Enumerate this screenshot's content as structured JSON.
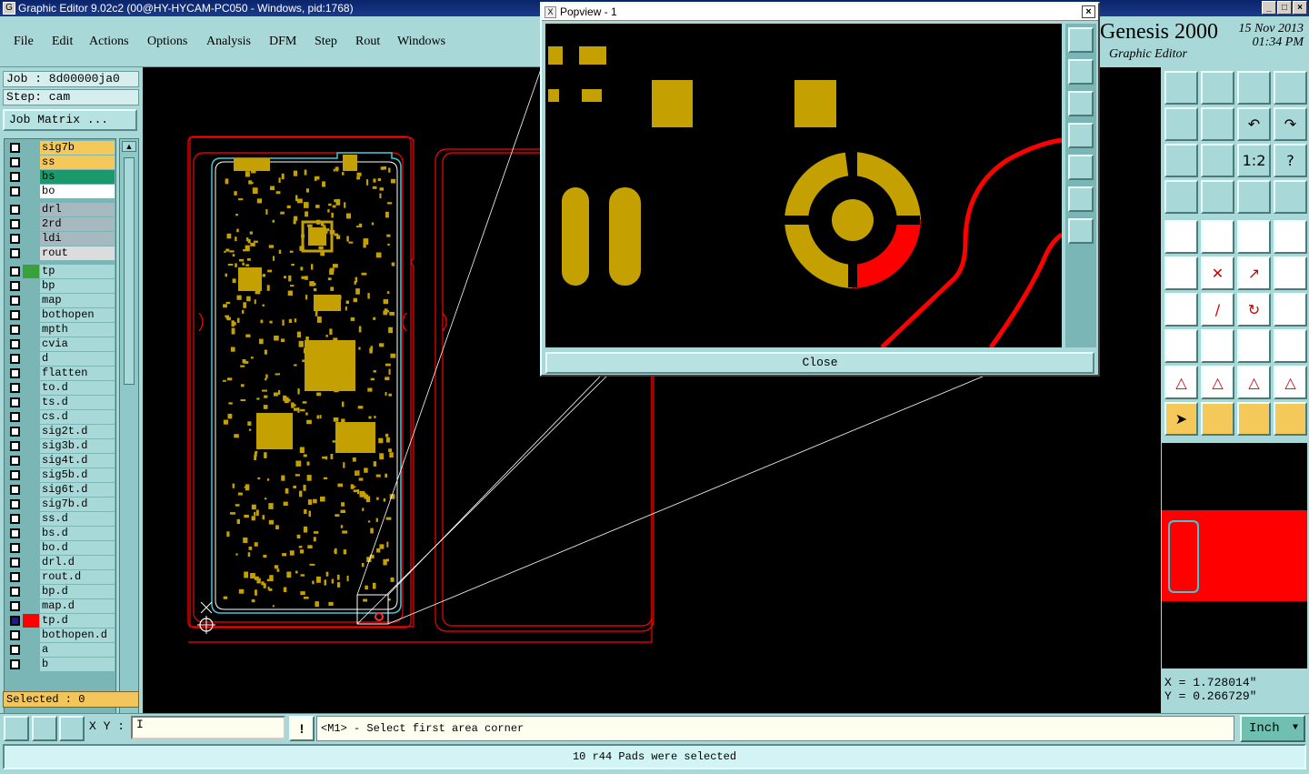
{
  "window": {
    "title": "Graphic Editor 9.02c2 (00@HY-HYCAM-PC050 - Windows, pid:1768)"
  },
  "menu": [
    "File",
    "Edit",
    "Actions",
    "Options",
    "Analysis",
    "DFM",
    "Step",
    "Rout",
    "Windows"
  ],
  "brand": {
    "name": "Genesis 2000",
    "subtitle": "Graphic Editor",
    "date": "15 Nov 2013",
    "time": "01:34 PM"
  },
  "job": {
    "label": "Job : 8d00000ja0",
    "step": "Step: cam",
    "matrix_button": "Job Matrix ..."
  },
  "layers": [
    {
      "name": "sig7b",
      "color": "#f5c85a",
      "swatch": ""
    },
    {
      "name": "ss",
      "color": "#f5c85a",
      "swatch": ""
    },
    {
      "name": "bs",
      "color": "#1a9a6a",
      "swatch": ""
    },
    {
      "name": "bo",
      "color": "#ffffff",
      "swatch": ""
    },
    {
      "name": "drl",
      "color": "#a8b8c0",
      "swatch": ""
    },
    {
      "name": "2rd",
      "color": "#a8b8c0",
      "swatch": ""
    },
    {
      "name": "ldi",
      "color": "#a8b8c0",
      "swatch": ""
    },
    {
      "name": "rout",
      "color": "#dcdcdc",
      "swatch": ""
    },
    {
      "name": "tp",
      "color": "#a8d8d8",
      "swatch": "#3aa03a"
    },
    {
      "name": "bp",
      "color": "#a8d8d8",
      "swatch": ""
    },
    {
      "name": "map",
      "color": "#a8d8d8",
      "swatch": ""
    },
    {
      "name": "bothopen",
      "color": "#a8d8d8",
      "swatch": ""
    },
    {
      "name": "mpth",
      "color": "#a8d8d8",
      "swatch": ""
    },
    {
      "name": "cvia",
      "color": "#a8d8d8",
      "swatch": ""
    },
    {
      "name": "d",
      "color": "#a8d8d8",
      "swatch": ""
    },
    {
      "name": "flatten",
      "color": "#a8d8d8",
      "swatch": ""
    },
    {
      "name": "to.d",
      "color": "#a8d8d8",
      "swatch": ""
    },
    {
      "name": "ts.d",
      "color": "#a8d8d8",
      "swatch": ""
    },
    {
      "name": "cs.d",
      "color": "#a8d8d8",
      "swatch": ""
    },
    {
      "name": "sig2t.d",
      "color": "#a8d8d8",
      "swatch": ""
    },
    {
      "name": "sig3b.d",
      "color": "#a8d8d8",
      "swatch": ""
    },
    {
      "name": "sig4t.d",
      "color": "#a8d8d8",
      "swatch": ""
    },
    {
      "name": "sig5b.d",
      "color": "#a8d8d8",
      "swatch": ""
    },
    {
      "name": "sig6t.d",
      "color": "#a8d8d8",
      "swatch": ""
    },
    {
      "name": "sig7b.d",
      "color": "#a8d8d8",
      "swatch": ""
    },
    {
      "name": "ss.d",
      "color": "#a8d8d8",
      "swatch": ""
    },
    {
      "name": "bs.d",
      "color": "#a8d8d8",
      "swatch": ""
    },
    {
      "name": "bo.d",
      "color": "#a8d8d8",
      "swatch": ""
    },
    {
      "name": "drl.d",
      "color": "#a8d8d8",
      "swatch": ""
    },
    {
      "name": "rout.d",
      "color": "#a8d8d8",
      "swatch": ""
    },
    {
      "name": "bp.d",
      "color": "#a8d8d8",
      "swatch": ""
    },
    {
      "name": "map.d",
      "color": "#a8d8d8",
      "swatch": ""
    },
    {
      "name": "tp.d",
      "color": "#a8d8d8",
      "swatch": "#ff0000"
    },
    {
      "name": "bothopen.d",
      "color": "#a8d8d8",
      "swatch": ""
    },
    {
      "name": "a",
      "color": "#a8d8d8",
      "swatch": ""
    },
    {
      "name": "b",
      "color": "#a8d8d8",
      "swatch": ""
    }
  ],
  "selected": "Selected : 0",
  "popview": {
    "title": "Popview - 1",
    "close": "Close"
  },
  "coords": {
    "x": "X = 1.728014\"",
    "y": "Y = 0.266729\""
  },
  "input": {
    "label": "X Y :",
    "value": "I",
    "prompt": "<M1> - Select first area corner",
    "unit": "Inch"
  },
  "status": "10 r44 Pads were selected",
  "colors": {
    "panel": "#a8d8d8",
    "pad": "#c4a000",
    "outline": "#ff0000",
    "profile": "#40c8d8"
  }
}
